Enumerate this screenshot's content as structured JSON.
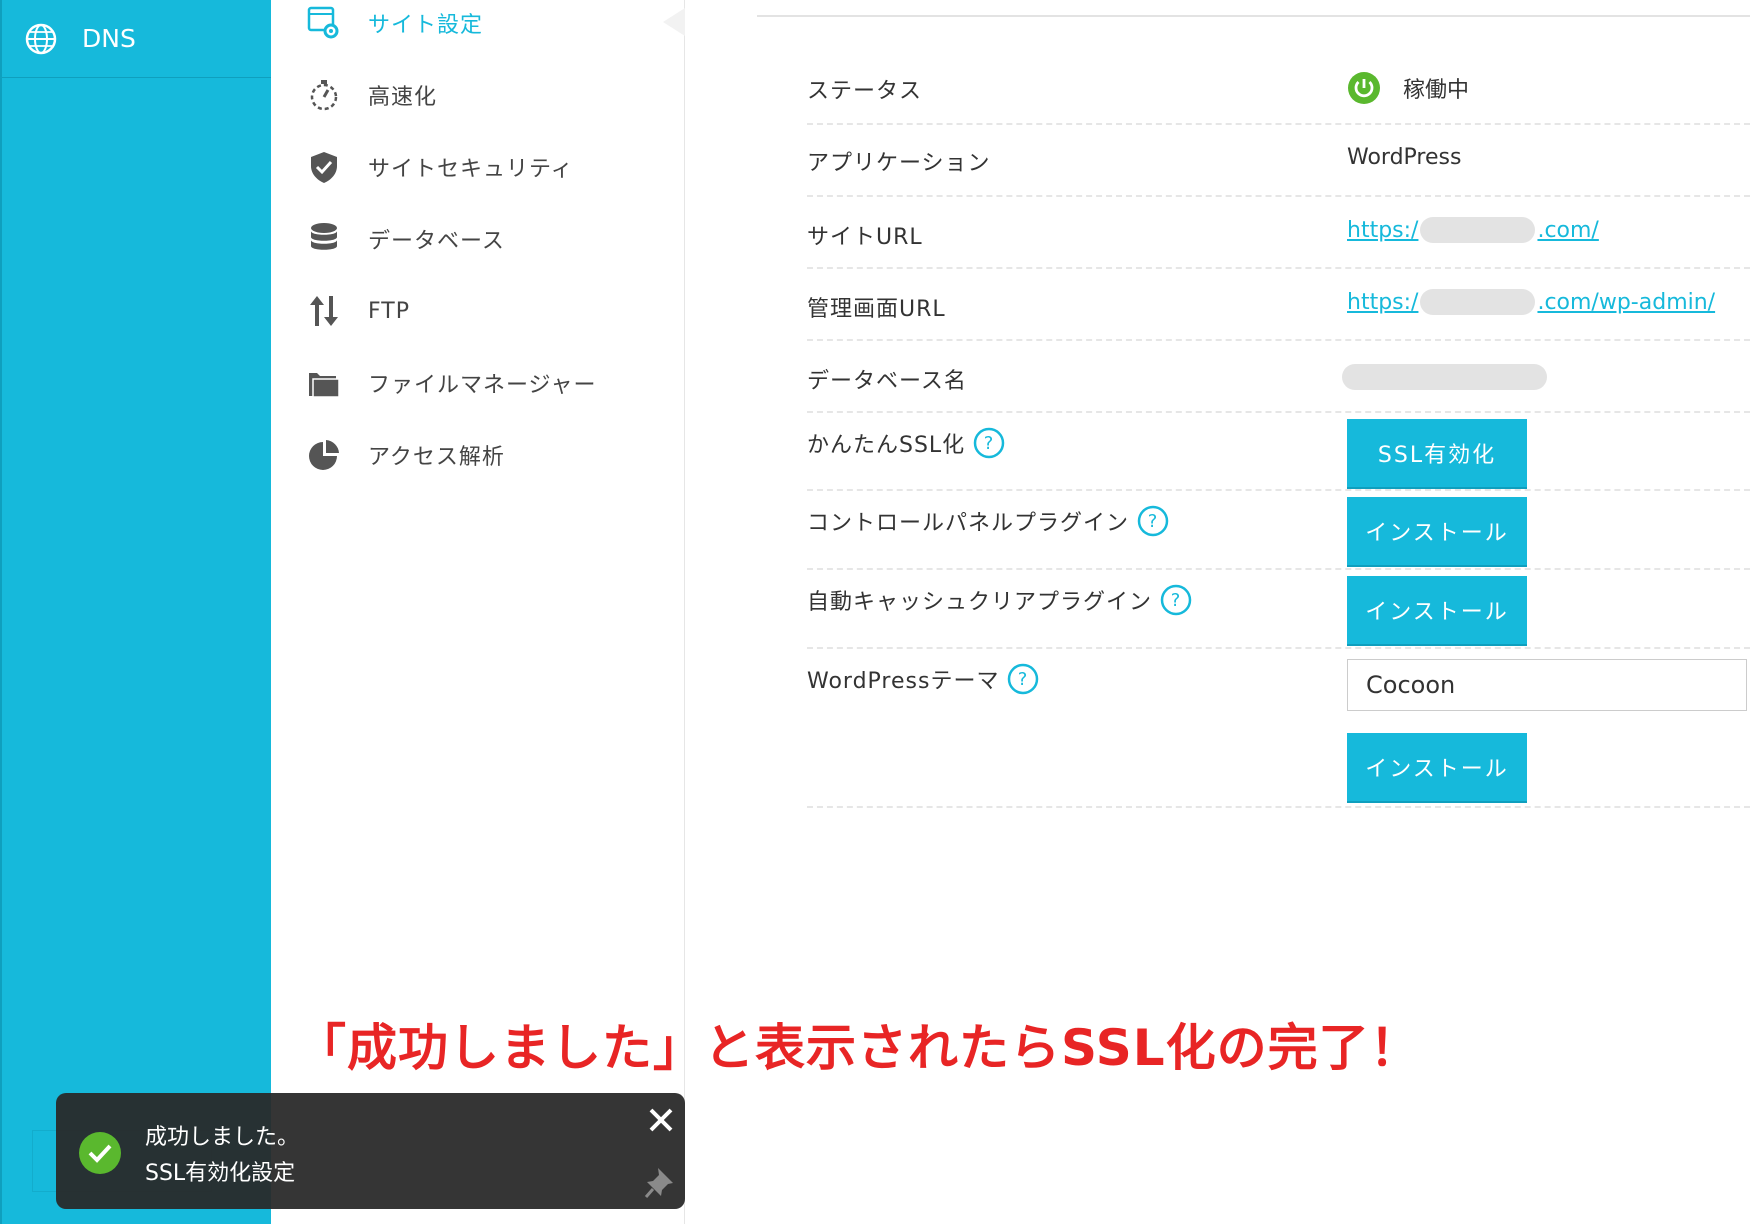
{
  "sidebar": {
    "dns_label": "DNS",
    "dns_icon": "globe-icon"
  },
  "submenu": {
    "items": [
      {
        "label": "サイト設定",
        "icon": "site-settings-gear-icon",
        "active": true
      },
      {
        "label": "高速化",
        "icon": "stopwatch-icon",
        "active": false
      },
      {
        "label": "サイトセキュリティ",
        "icon": "shield-check-icon",
        "active": false
      },
      {
        "label": "データベース",
        "icon": "database-icon",
        "active": false
      },
      {
        "label": "FTP",
        "icon": "up-down-arrows-icon",
        "active": false
      },
      {
        "label": "ファイルマネージャー",
        "icon": "folder-icon",
        "active": false
      },
      {
        "label": "アクセス解析",
        "icon": "pie-chart-icon",
        "active": false
      }
    ]
  },
  "details": {
    "status_label": "ステータス",
    "status_value": "稼働中",
    "application_label": "アプリケーション",
    "application_value": "WordPress",
    "site_url_label": "サイトURL",
    "site_url_prefix": "https:/",
    "site_url_suffix": ".com/",
    "admin_url_label": "管理画面URL",
    "admin_url_prefix": "https:/",
    "admin_url_suffix": ".com/wp-admin/",
    "db_name_label": "データベース名",
    "ssl_label": "かんたんSSL化",
    "ssl_button": "SSL有効化",
    "cp_plugin_label": "コントロールパネルプラグイン",
    "cp_plugin_button": "インストール",
    "cache_plugin_label": "自動キャッシュクリアプラグイン",
    "cache_plugin_button": "インストール",
    "theme_label": "WordPressテーマ",
    "theme_selected": "Cocoon",
    "theme_button": "インストール"
  },
  "annotation": "「成功しました」と表示されたらSSL化の完了！",
  "toast": {
    "title": "成功しました。",
    "message": "SSL有効化設定"
  },
  "colors": {
    "accent": "#16b9db",
    "status_green": "#5ab82e",
    "annotation_red": "#e82525",
    "toast_bg": "#282828"
  }
}
